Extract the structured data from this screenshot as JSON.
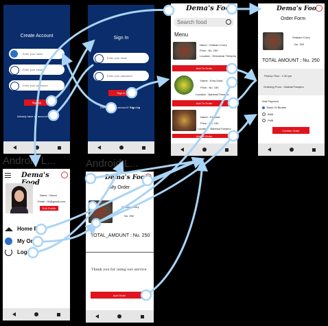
{
  "frame_labels": {
    "profile": "Android L...",
    "thankyou": "Android L..."
  },
  "brand": {
    "name": "Dema's Food"
  },
  "create_account": {
    "title": "Create Account",
    "name_placeholder": "Enter your name",
    "email_placeholder": "Enter your email",
    "password_placeholder": "Enter your password",
    "button": "Sign up",
    "footer": "Already have an account? Login"
  },
  "sign_in": {
    "title": "Sign In",
    "email_placeholder": "Enter your email",
    "password_placeholder": "Enter your password",
    "button": "Sign in",
    "footer_prefix": "Don't have an account?",
    "footer_link": "Sign Up"
  },
  "menu": {
    "search_placeholder": "Search food",
    "title": "Menu",
    "items": [
      {
        "name": "Name : Shakam Curry",
        "price": "Price : Nu. 250",
        "location": "Location : Emkokhar Thimphu",
        "button": "Add To Order"
      },
      {
        "name": "Name : Ema Datsi",
        "price": "Price : Nu. 150",
        "location": "Location : Babesa/Thimphu",
        "button": "Add To Order"
      },
      {
        "name": "Name : Pa datsi",
        "price": "Price : Nu. 150",
        "location": "Location : Babesa/Thimphu",
        "button": "Add To Order"
      }
    ]
  },
  "order_form": {
    "title": "Order Form",
    "item_name": "Shakam Curry",
    "item_price": "Nu. 250",
    "total": "TOTAL AMOUNT : Nu. 250",
    "pickup": "PickUp Time : 1:30 pm",
    "ordering_from": "Ordering From : Olakha/Thimphu",
    "payment_title": "Add Payment",
    "payment_options": [
      "Bank Of Bhutan",
      "BNB",
      "PNB"
    ],
    "button": "Confirm Order"
  },
  "profile": {
    "name": "Name : Dema",
    "email": "Email : 00@gmail.com",
    "edit_button": "Edit Profile",
    "nav": [
      "Home Page",
      "My Order",
      "LogOut"
    ]
  },
  "my_order": {
    "title": "My Order",
    "item_name": "Shakam Curry",
    "item_price": "Nu. 250",
    "total": "TOTAL_AMOUNT : Nu. 250",
    "thanks": "Thank you for using our service",
    "button": "Add Order"
  },
  "colors": {
    "navy": "#0b2d6b",
    "accent_red": "#e0141e",
    "wire": "#a9d4f5",
    "pill_blue": "#2e6fc9"
  }
}
